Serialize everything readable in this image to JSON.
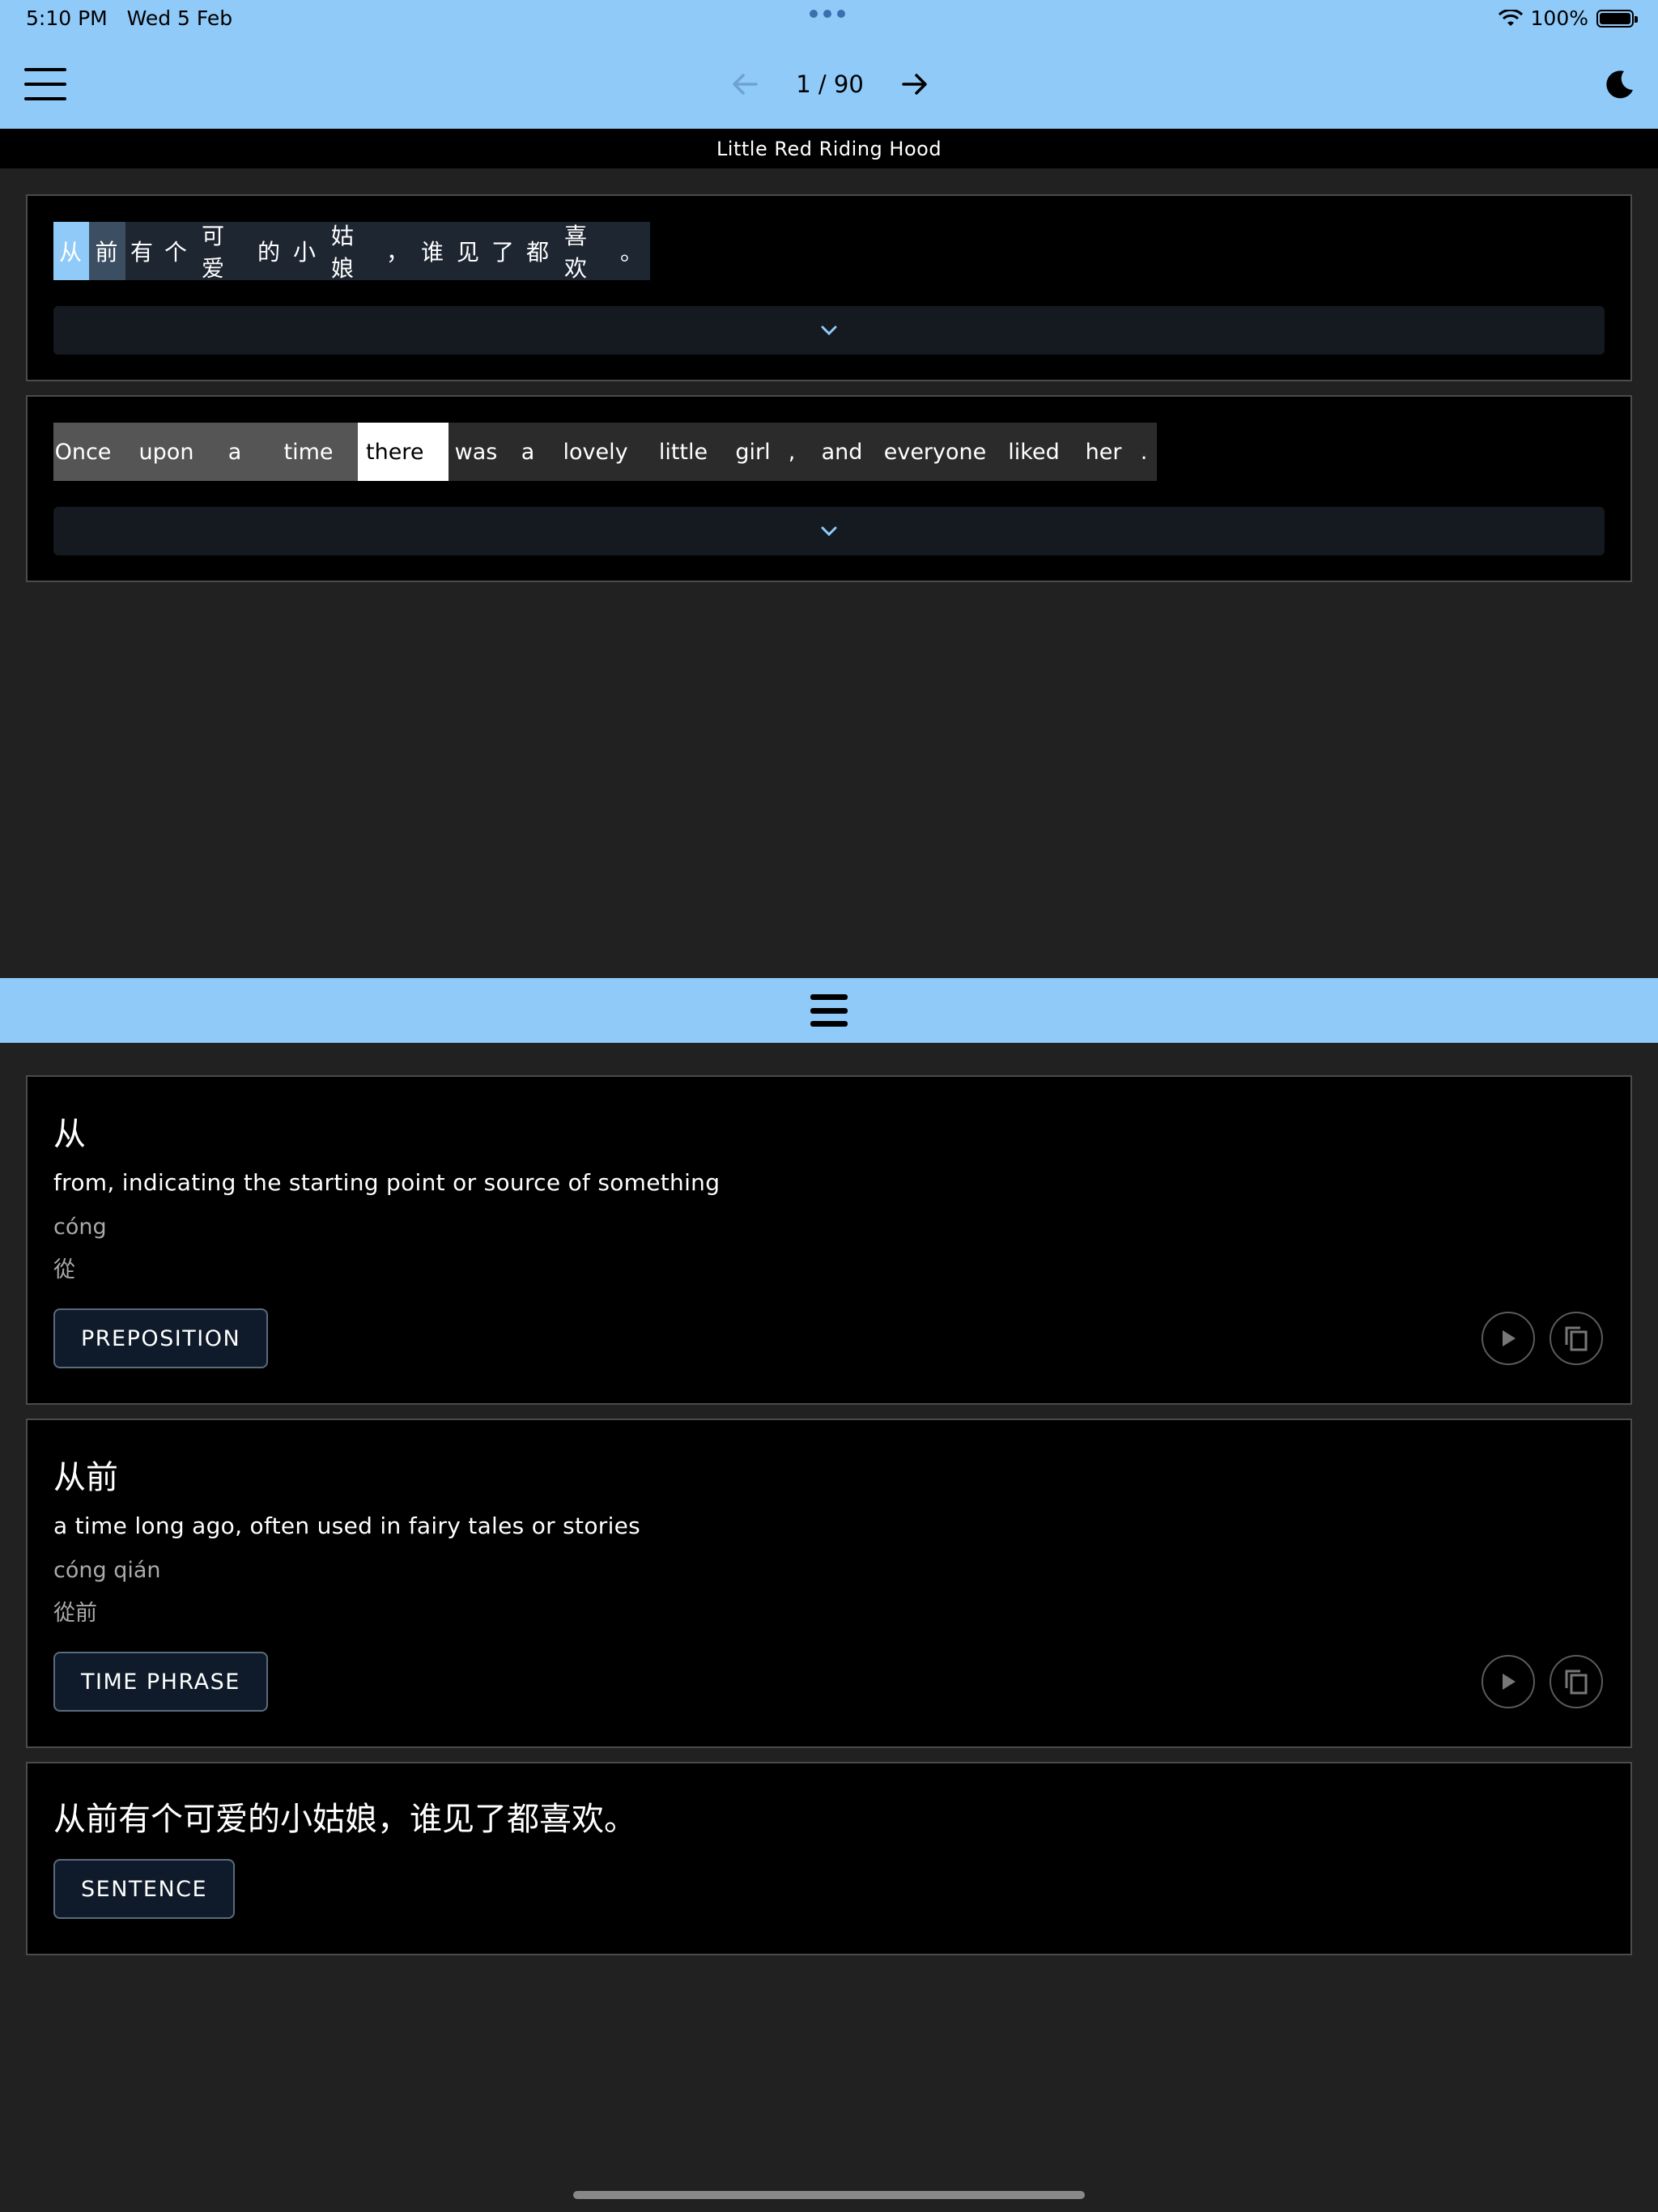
{
  "status_bar": {
    "time": "5:10 PM",
    "date": "Wed 5 Feb",
    "battery": "100%"
  },
  "nav": {
    "page": "1 / 90"
  },
  "story_title": "Little Red Riding Hood",
  "chinese_tokens": [
    "从",
    "前",
    "有",
    "个",
    "可爱",
    "的",
    "小",
    "姑娘",
    "，",
    "谁",
    "见",
    "了",
    "都",
    "喜欢",
    "。"
  ],
  "english_tokens": [
    "Once",
    "upon",
    "a",
    "time",
    "there",
    "was",
    "a",
    "lovely",
    "little",
    "girl",
    ",",
    "and",
    "everyone",
    "liked",
    "her",
    "."
  ],
  "entries": [
    {
      "word": "从",
      "meaning": "from, indicating the starting point or source of something",
      "pinyin": "cóng",
      "traditional": "從",
      "tag": "PREPOSITION"
    },
    {
      "word": "从前",
      "meaning": "a time long ago, often used in fairy tales or stories",
      "pinyin": "cóng qián",
      "traditional": "從前",
      "tag": "TIME PHRASE"
    }
  ],
  "sentence": {
    "text": "从前有个可爱的小姑娘，谁见了都喜欢。",
    "tag": "SENTENCE"
  }
}
